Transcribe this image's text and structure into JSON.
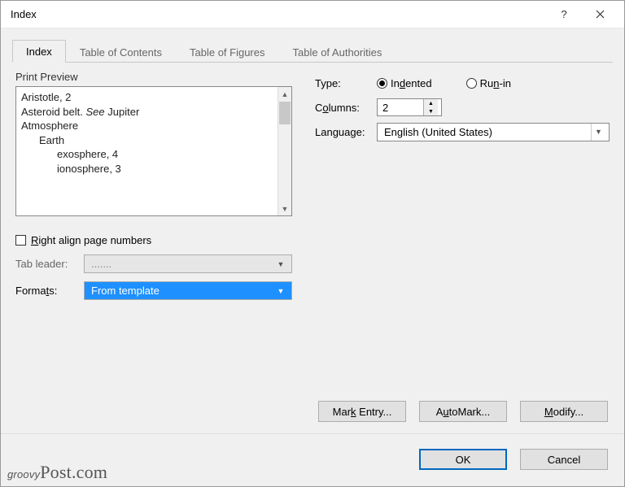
{
  "title": "Index",
  "tabs": [
    "Index",
    "Table of Contents",
    "Table of Figures",
    "Table of Authorities"
  ],
  "active_tab": 0,
  "preview_label": "Print Preview",
  "preview_lines": [
    {
      "text": "Aristotle, 2",
      "indent": 0
    },
    {
      "text_pre": "Asteroid belt. ",
      "text_it": "See",
      "text_post": " Jupiter",
      "indent": 0
    },
    {
      "text": "Atmosphere",
      "indent": 0
    },
    {
      "text": "Earth",
      "indent": 1
    },
    {
      "text": "exosphere, 4",
      "indent": 2
    },
    {
      "text": "ionosphere, 3",
      "indent": 2
    }
  ],
  "right_align": {
    "label": "Right align page numbers",
    "checked": false
  },
  "tab_leader": {
    "label": "Tab leader:",
    "value": ".......",
    "enabled": false
  },
  "formats": {
    "label": "Formats:",
    "value": "From template",
    "open": true
  },
  "type": {
    "label": "Type:",
    "options": [
      "Indented",
      "Run-in"
    ],
    "selected": 0
  },
  "columns": {
    "label": "Columns:",
    "value": "2 "
  },
  "language": {
    "label": "Language:",
    "value": "English (United States)"
  },
  "buttons_mid": [
    "Mark Entry...",
    "AutoMark...",
    "Modify..."
  ],
  "buttons_footer": {
    "ok": "OK",
    "cancel": "Cancel"
  },
  "watermark": "groovyPost.com"
}
